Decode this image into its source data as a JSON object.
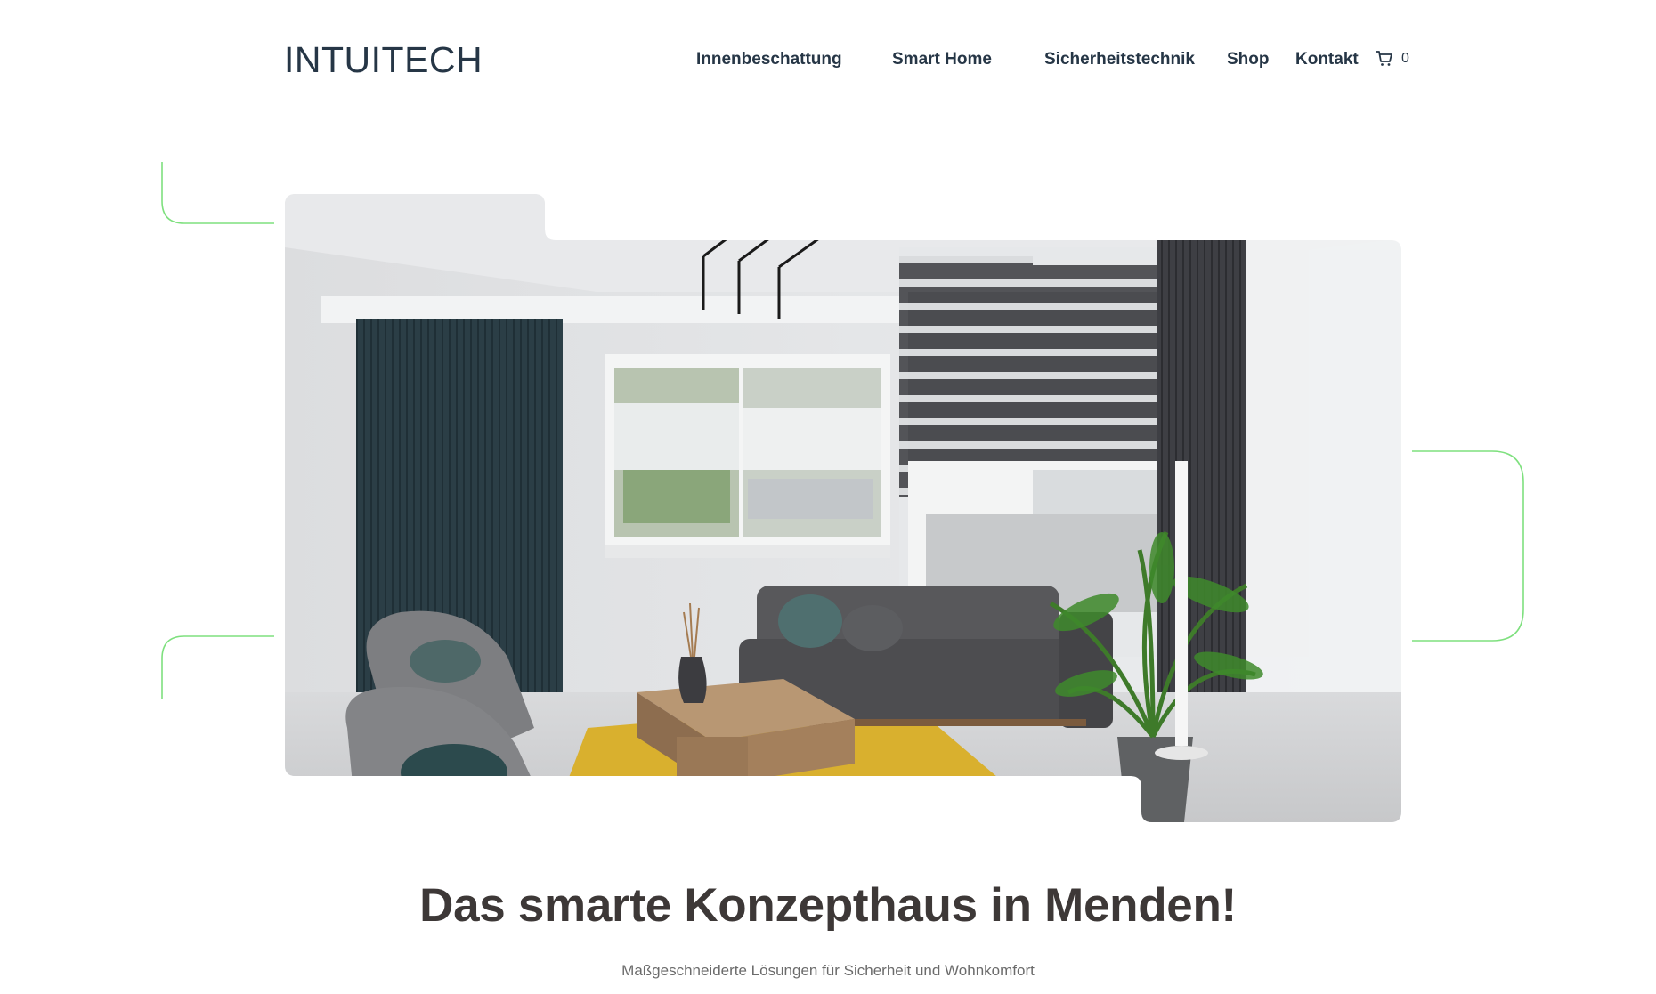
{
  "brand": {
    "name": "INTUITECH"
  },
  "nav": {
    "items": [
      {
        "label": "Innenbeschattung"
      },
      {
        "label": "Smart Home"
      },
      {
        "label": "Sicherheitstechnik"
      },
      {
        "label": "Shop"
      },
      {
        "label": "Kontakt"
      }
    ]
  },
  "cart": {
    "icon": "cart-icon",
    "count": "0"
  },
  "hero": {
    "image": "living-room-photo",
    "headline": "Das smarte Konzepthaus in Menden!",
    "subline": "Maßgeschneiderte Lösungen für Sicherheit und Wohnkomfort"
  },
  "colors": {
    "accent": "#7ee07e",
    "text": "#263646",
    "headline": "#3d3837"
  }
}
